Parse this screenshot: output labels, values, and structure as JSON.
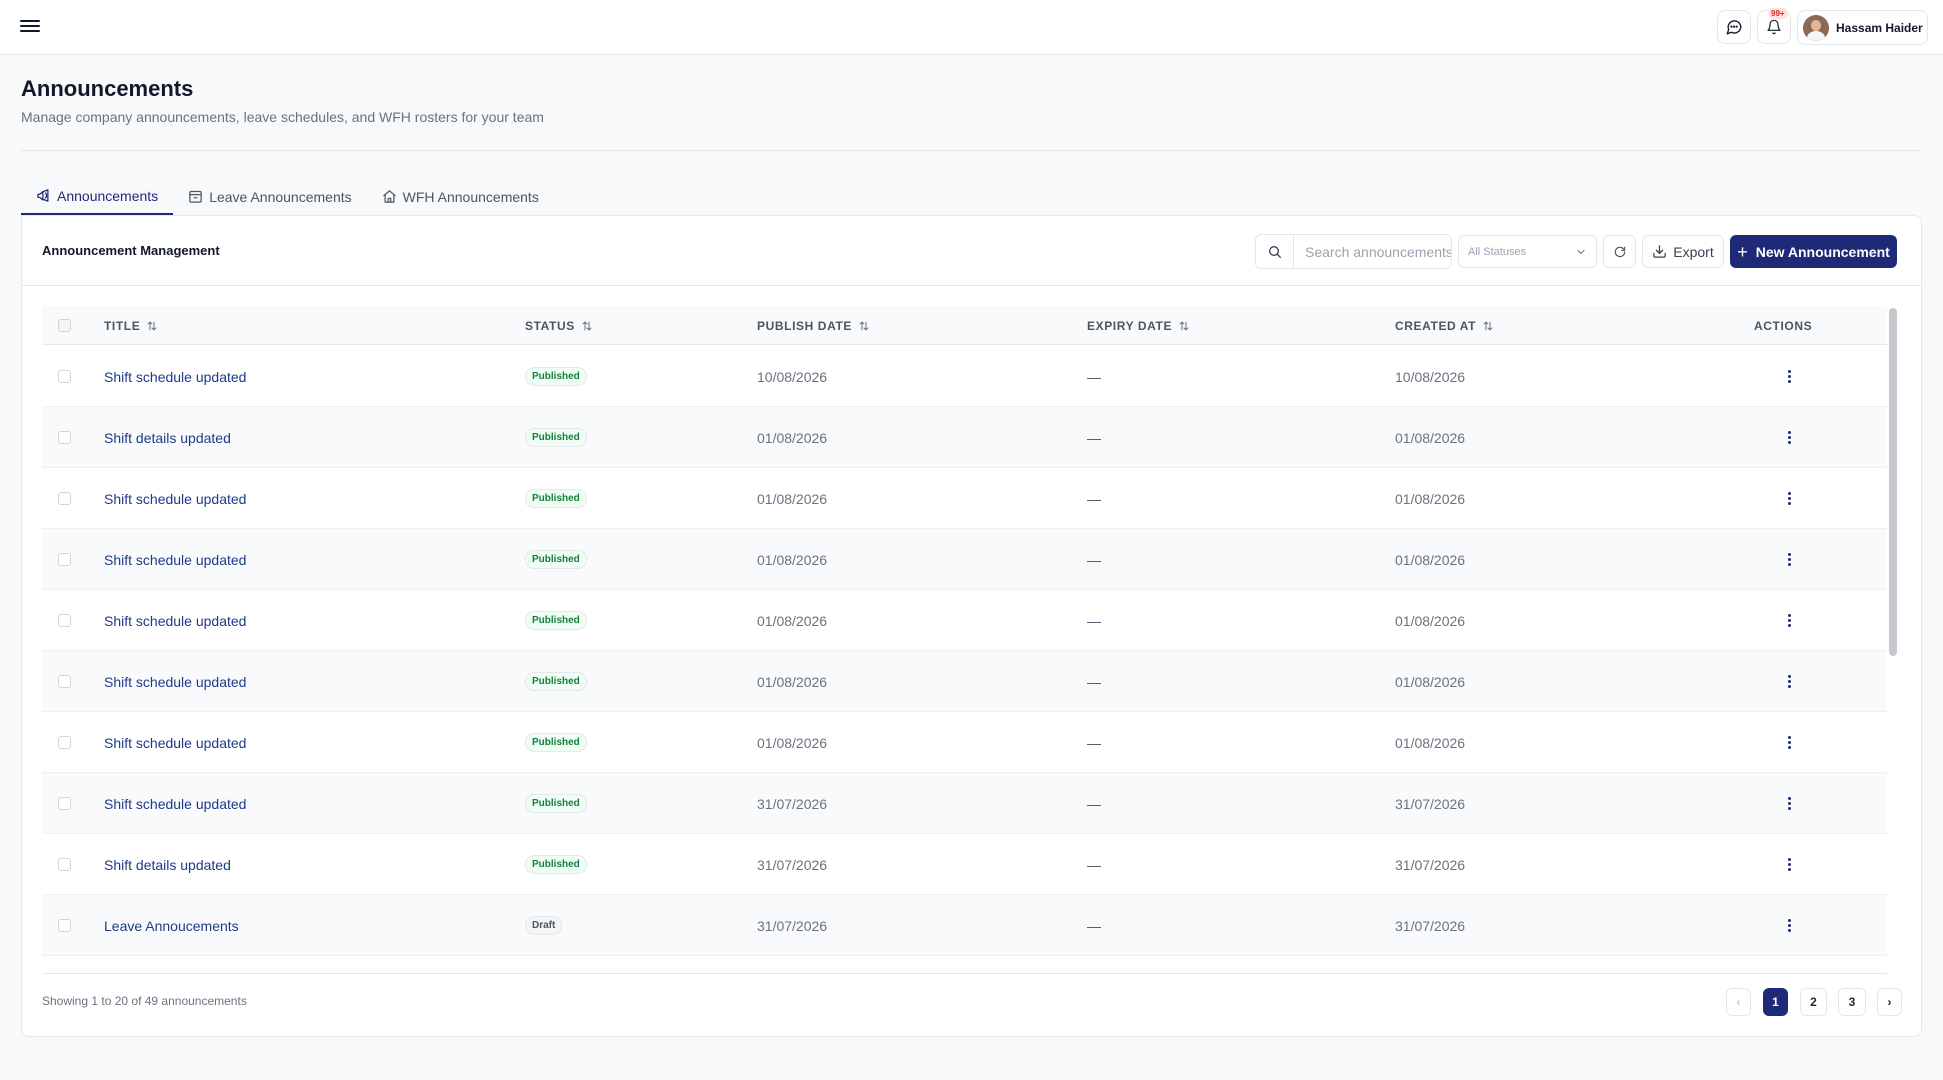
{
  "topbar": {
    "notification_badge": "99+",
    "user_name": "Hassam Haider"
  },
  "page": {
    "title": "Announcements",
    "subtitle": "Manage company announcements, leave schedules, and WFH rosters for your team"
  },
  "tabs": [
    {
      "label": "Announcements",
      "active": true,
      "icon": "megaphone-icon"
    },
    {
      "label": "Leave Announcements",
      "active": false,
      "icon": "calendar-icon"
    },
    {
      "label": "WFH Announcements",
      "active": false,
      "icon": "home-icon"
    }
  ],
  "card": {
    "title": "Announcement Management",
    "search_placeholder": "Search announcements...",
    "status_filter": "All Statuses",
    "export_label": "Export",
    "new_label": "New Announcement"
  },
  "table": {
    "columns": [
      "TITLE",
      "STATUS",
      "PUBLISH DATE",
      "EXPIRY DATE",
      "CREATED AT",
      "ACTIONS"
    ],
    "rows": [
      {
        "title": "Shift schedule updated",
        "status": "Published",
        "publish": "10/08/2026",
        "expiry": "—",
        "created": "10/08/2026"
      },
      {
        "title": "Shift details updated",
        "status": "Published",
        "publish": "01/08/2026",
        "expiry": "—",
        "created": "01/08/2026"
      },
      {
        "title": "Shift schedule updated",
        "status": "Published",
        "publish": "01/08/2026",
        "expiry": "—",
        "created": "01/08/2026"
      },
      {
        "title": "Shift schedule updated",
        "status": "Published",
        "publish": "01/08/2026",
        "expiry": "—",
        "created": "01/08/2026"
      },
      {
        "title": "Shift schedule updated",
        "status": "Published",
        "publish": "01/08/2026",
        "expiry": "—",
        "created": "01/08/2026"
      },
      {
        "title": "Shift schedule updated",
        "status": "Published",
        "publish": "01/08/2026",
        "expiry": "—",
        "created": "01/08/2026"
      },
      {
        "title": "Shift schedule updated",
        "status": "Published",
        "publish": "01/08/2026",
        "expiry": "—",
        "created": "01/08/2026"
      },
      {
        "title": "Shift schedule updated",
        "status": "Published",
        "publish": "31/07/2026",
        "expiry": "—",
        "created": "31/07/2026"
      },
      {
        "title": "Shift details updated",
        "status": "Published",
        "publish": "31/07/2026",
        "expiry": "—",
        "created": "31/07/2026"
      },
      {
        "title": "Leave Annoucements",
        "status": "Draft",
        "publish": "31/07/2026",
        "expiry": "—",
        "created": "31/07/2026"
      }
    ]
  },
  "footer": {
    "showing": "Showing 1 to 20 of 49 announcements",
    "prev": "‹",
    "next": "›",
    "pages": [
      "1",
      "2",
      "3"
    ],
    "current_page": "1"
  },
  "colors": {
    "primary": "#1e2a78",
    "published_text": "#15803d",
    "link": "#1e3a8a"
  }
}
